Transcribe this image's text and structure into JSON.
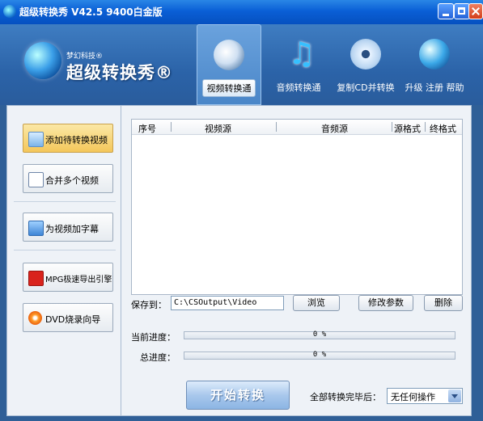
{
  "window": {
    "title": "超级转换秀  V42.5  9400白金版"
  },
  "header": {
    "logo_sub": "梦幻科技®",
    "logo_main": "超级转换秀®",
    "tabs": [
      {
        "label": "视频转换通",
        "icon": "film-reel-icon",
        "active": true
      },
      {
        "label": "音频转换通",
        "icon": "music-note-icon",
        "active": false
      },
      {
        "label": "复制CD并转换",
        "icon": "cd-disc-icon",
        "active": false
      },
      {
        "label": "升级 注册 帮助",
        "icon": "globe-icon",
        "active": false
      }
    ]
  },
  "sidebar": {
    "items": [
      {
        "label": "添加待转换视频",
        "icon": "add-video-icon",
        "active": true
      },
      {
        "label": "合并多个视频",
        "icon": "merge-document-icon",
        "active": false
      },
      {
        "label": "为视频加字幕",
        "icon": "subtitle-icon",
        "active": false
      },
      {
        "label": "MPG极速导出引擎",
        "icon": "mpg-export-icon",
        "active": false
      },
      {
        "label": "DVD烧录向导",
        "icon": "dvd-burn-icon",
        "active": false
      }
    ]
  },
  "list": {
    "columns": [
      "序号",
      "视频源",
      "音频源",
      "源格式",
      "终格式"
    ],
    "rows": []
  },
  "output": {
    "save_label": "保存到：",
    "path": "C:\\CSOutput\\Video",
    "browse": "浏览",
    "modify": "修改参数",
    "delete": "删除"
  },
  "progress": {
    "current_label": "当前进度：",
    "current_value": "0 %",
    "current_fraction": 0,
    "total_label": "总进度：",
    "total_value": "0 %",
    "total_fraction": 0
  },
  "action": {
    "start": "开始转换",
    "after_label": "全部转换完毕后：",
    "after_value": "无任何操作"
  }
}
